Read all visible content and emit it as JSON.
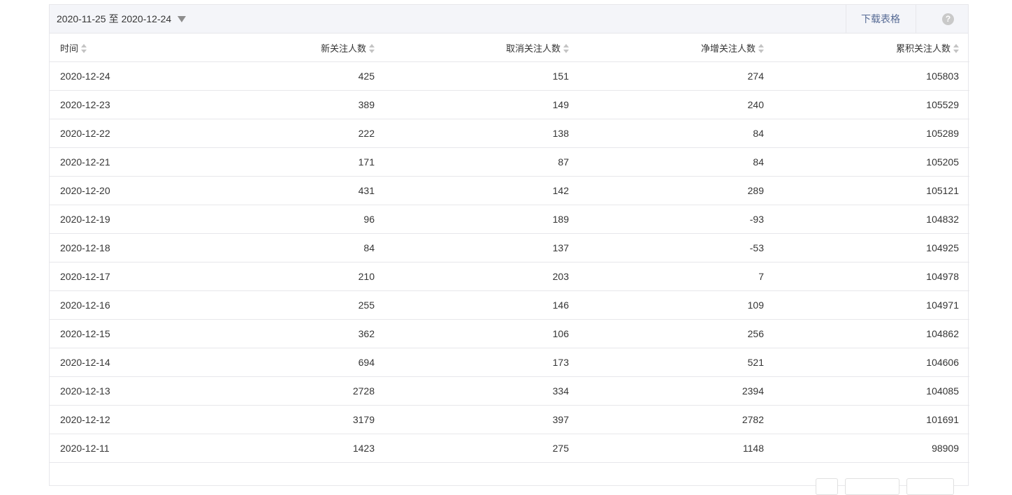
{
  "toolbar": {
    "date_start": "2020-11-25",
    "date_sep": "至",
    "date_end": "2020-12-24",
    "download_label": "下载表格",
    "help_label": "?"
  },
  "table": {
    "headers": [
      "时间",
      "新关注人数",
      "取消关注人数",
      "净增关注人数",
      "累积关注人数"
    ],
    "rows": [
      [
        "2020-12-24",
        "425",
        "151",
        "274",
        "105803"
      ],
      [
        "2020-12-23",
        "389",
        "149",
        "240",
        "105529"
      ],
      [
        "2020-12-22",
        "222",
        "138",
        "84",
        "105289"
      ],
      [
        "2020-12-21",
        "171",
        "87",
        "84",
        "105205"
      ],
      [
        "2020-12-20",
        "431",
        "142",
        "289",
        "105121"
      ],
      [
        "2020-12-19",
        "96",
        "189",
        "-93",
        "104832"
      ],
      [
        "2020-12-18",
        "84",
        "137",
        "-53",
        "104925"
      ],
      [
        "2020-12-17",
        "210",
        "203",
        "7",
        "104978"
      ],
      [
        "2020-12-16",
        "255",
        "146",
        "109",
        "104971"
      ],
      [
        "2020-12-15",
        "362",
        "106",
        "256",
        "104862"
      ],
      [
        "2020-12-14",
        "694",
        "173",
        "521",
        "104606"
      ],
      [
        "2020-12-13",
        "2728",
        "334",
        "2394",
        "104085"
      ],
      [
        "2020-12-12",
        "3179",
        "397",
        "2782",
        "101691"
      ],
      [
        "2020-12-11",
        "1423",
        "275",
        "1148",
        "98909"
      ]
    ]
  },
  "colors": {
    "link": "#576b95",
    "border": "#e7e7eb",
    "toolbar_bg": "#f4f5f9",
    "text": "#353535"
  },
  "icons": [
    "caret-down-icon",
    "help-icon",
    "sort-icon"
  ]
}
